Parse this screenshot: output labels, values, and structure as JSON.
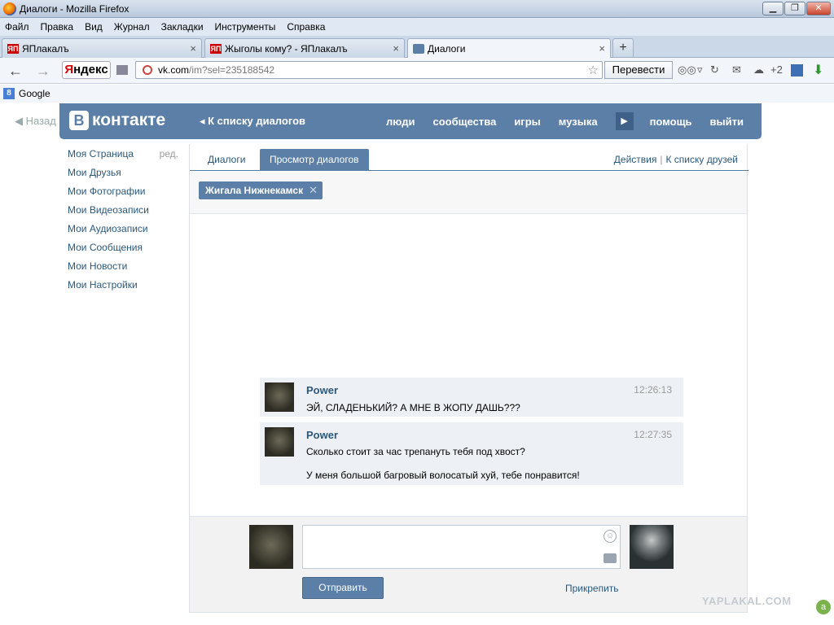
{
  "window": {
    "title": "Диалоги - Mozilla Firefox",
    "minimize": "▁",
    "maximize": "❐",
    "close": "✕"
  },
  "menu": [
    "Файл",
    "Правка",
    "Вид",
    "Журнал",
    "Закладки",
    "Инструменты",
    "Справка"
  ],
  "tabs": [
    {
      "favicon": "ЯП",
      "label": "ЯПлакалъ",
      "close": "×"
    },
    {
      "favicon": "ЯП",
      "label": "Жыголы кому? - ЯПлакалъ",
      "close": "×"
    },
    {
      "favicon": "",
      "label": "Диалоги",
      "close": "×"
    }
  ],
  "newtab": "+",
  "nav": {
    "back": "←",
    "forward": "→",
    "yandex_ya": "Я",
    "yandex_rest": "ндекс",
    "url_host": "vk.com",
    "url_path": "/im?sel=235188542",
    "star": "☆",
    "translate": "Перевести",
    "extras_count": "+2"
  },
  "bookmarks": [
    {
      "icon": "8",
      "label": "Google"
    }
  ],
  "vk": {
    "back_left": "◀  Назад",
    "logo_letter": "В",
    "logo_word": "контакте",
    "back_to_dialogs": "◂  К списку диалогов",
    "top_nav": [
      "люди",
      "сообщества",
      "игры",
      "музыка"
    ],
    "more_arrow": "▶",
    "help": "помощь",
    "logout": "выйти",
    "left_menu": [
      "Моя Страница",
      "Мои Друзья",
      "Мои Фотографии",
      "Мои Видеозаписи",
      "Мои Аудиозаписи",
      "Мои Сообщения",
      "Мои Новости",
      "Мои Настройки"
    ],
    "left_edit": "ред.",
    "tab_dialogs": "Диалоги",
    "tab_view": "Просмотр диалогов",
    "action_actions": "Действия",
    "action_sep": "|",
    "action_friends": "К списку друзей",
    "recipient": "Жигала Нижнекамск",
    "recipient_remove": "✕",
    "messages": [
      {
        "author": "Power",
        "time": "12:26:13",
        "lines": [
          "ЭЙ, СЛАДЕНЬКИЙ? А МНЕ В ЖОПУ ДАШЬ???"
        ]
      },
      {
        "author": "Power",
        "time": "12:27:35",
        "lines": [
          "Сколько стоит за час трепануть тебя под хвост?",
          "У меня большой багровый волосатый хуй, тебе понравится!"
        ]
      }
    ],
    "send": "Отправить",
    "attach": "Прикрепить",
    "smile": "☺"
  },
  "watermark": "YAPLAKAL.COM",
  "watermark_badge": "a"
}
